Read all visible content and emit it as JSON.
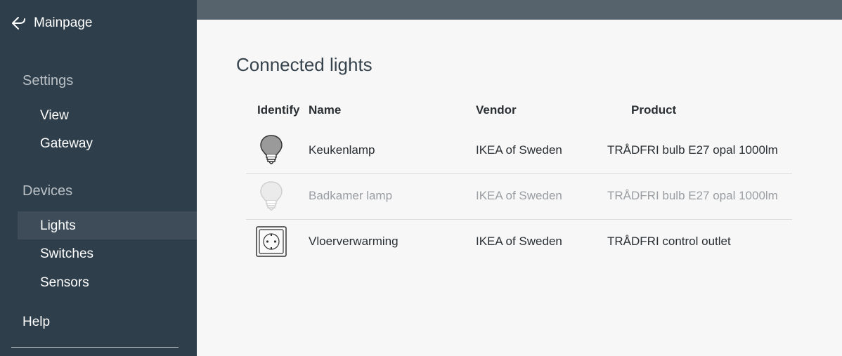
{
  "sidebar": {
    "back_label": "Mainpage",
    "sections": [
      {
        "label": "Settings",
        "items": [
          "View",
          "Gateway"
        ]
      },
      {
        "label": "Devices",
        "items": [
          "Lights",
          "Switches",
          "Sensors"
        ]
      }
    ],
    "active_item": "Lights",
    "help_label": "Help"
  },
  "main": {
    "title": "Connected lights",
    "columns": [
      "Identify",
      "Name",
      "Vendor",
      "Product"
    ],
    "rows": [
      {
        "icon": "bulb-icon",
        "name": "Keukenlamp",
        "vendor": "IKEA of Sweden",
        "product": "TRÅDFRI bulb E27 opal 1000lm",
        "dimmed": false
      },
      {
        "icon": "bulb-icon",
        "name": "Badkamer lamp",
        "vendor": "IKEA of Sweden",
        "product": "TRÅDFRI bulb E27 opal 1000lm",
        "dimmed": true
      },
      {
        "icon": "outlet-icon",
        "name": "Vloerverwarming",
        "vendor": "IKEA of Sweden",
        "product": "TRÅDFRI control outlet",
        "dimmed": false
      }
    ]
  },
  "colors": {
    "sidebar_bg": "#2e3e4a",
    "sidebar_active_bg": "#3d4c58",
    "topbar_bg": "#56636c",
    "main_bg": "#f7f7f7",
    "dimmed_text": "#9a9ea2"
  }
}
